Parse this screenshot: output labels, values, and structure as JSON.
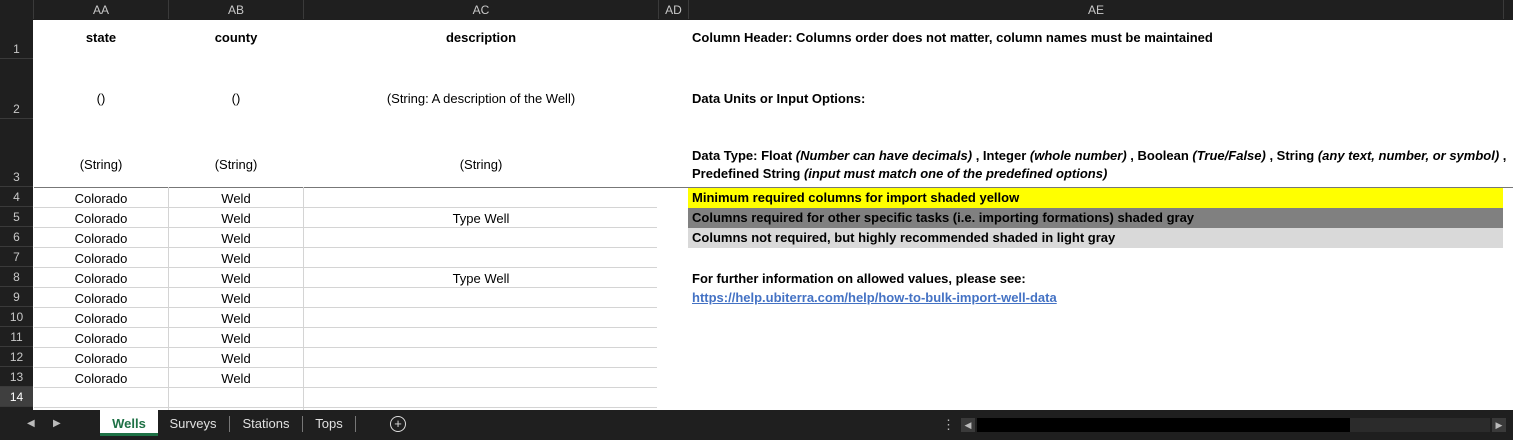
{
  "columns": [
    "AA",
    "AB",
    "AC",
    "AD",
    "AE"
  ],
  "rows": [
    "1",
    "2",
    "3",
    "4",
    "5",
    "6",
    "7",
    "8",
    "9",
    "10",
    "11",
    "12",
    "13",
    "14"
  ],
  "headers": {
    "state": "state",
    "county": "county",
    "description": "description"
  },
  "units": {
    "state": "()",
    "county": "()",
    "description": "(String: A description of the Well)"
  },
  "types": {
    "state": "(String)",
    "county": "(String)",
    "description": "(String)"
  },
  "data_rows": [
    {
      "state": "Colorado",
      "county": "Weld",
      "description": ""
    },
    {
      "state": "Colorado",
      "county": "Weld",
      "description": "Type Well"
    },
    {
      "state": "Colorado",
      "county": "Weld",
      "description": ""
    },
    {
      "state": "Colorado",
      "county": "Weld",
      "description": ""
    },
    {
      "state": "Colorado",
      "county": "Weld",
      "description": "Type Well"
    },
    {
      "state": "Colorado",
      "county": "Weld",
      "description": ""
    },
    {
      "state": "Colorado",
      "county": "Weld",
      "description": ""
    },
    {
      "state": "Colorado",
      "county": "Weld",
      "description": ""
    },
    {
      "state": "Colorado",
      "county": "Weld",
      "description": ""
    },
    {
      "state": "Colorado",
      "county": "Weld",
      "description": ""
    }
  ],
  "info": {
    "column_header": "Column Header: Columns order does not matter, column names must be maintained",
    "data_units": "Data Units or Input Options:",
    "data_type_prefix": "Data Type: Float ",
    "float_note": "(Number can have decimals)",
    "integer_label": " , Integer ",
    "integer_note": "(whole number)",
    "boolean_label": " , Boolean ",
    "boolean_note": "(True/False)",
    "string_label": " , String ",
    "string_note": "(any text, number, or symbol)",
    "trailing_comma": " ,",
    "predefined_label": "Predefined String ",
    "predefined_note": "(input must match one of the predefined options)",
    "legend_yellow": "Minimum required columns for import shaded yellow",
    "legend_gray": "Columns required for other specific tasks (i.e. importing formations) shaded gray",
    "legend_lightgray": "Columns not required, but highly recommended shaded in light gray",
    "further_info": "For further information on allowed values, please see:",
    "link": "https://help.ubiterra.com/help/how-to-bulk-import-well-data"
  },
  "legend_colors": {
    "yellow": "#ffff00",
    "gray": "#808080",
    "lightgray": "#d9d9d9"
  },
  "sheet_tabs": [
    "Wells",
    "Surveys",
    "Stations",
    "Tops"
  ],
  "active_tab": "Wells",
  "accent_color": "#1e7145"
}
